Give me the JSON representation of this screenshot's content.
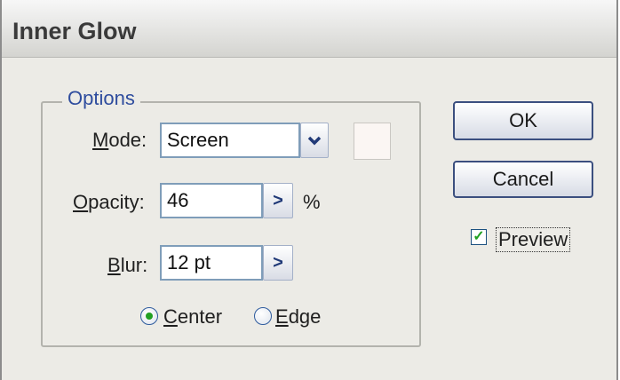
{
  "window": {
    "title": "Inner Glow"
  },
  "options": {
    "legend": "Options",
    "mode": {
      "label_accel": "M",
      "label_rest": "ode:",
      "value": "Screen",
      "dropdown_icon": "chevron-down-icon"
    },
    "opacity": {
      "label_accel": "O",
      "label_rest": "pacity:",
      "value": "46",
      "unit": "%",
      "stepper_glyph": ">"
    },
    "blur": {
      "label_accel": "B",
      "label_rest": "lur:",
      "value": "12 pt",
      "stepper_glyph": ">"
    },
    "glow_source": {
      "center": {
        "accel": "C",
        "rest": "enter",
        "selected": true
      },
      "edge": {
        "accel": "E",
        "rest": "dge",
        "selected": false
      }
    },
    "glow_color": "#fbf6f3"
  },
  "buttons": {
    "ok": "OK",
    "cancel": "Cancel"
  },
  "preview": {
    "label": "Preview",
    "checked": true,
    "check_glyph": "✓"
  }
}
